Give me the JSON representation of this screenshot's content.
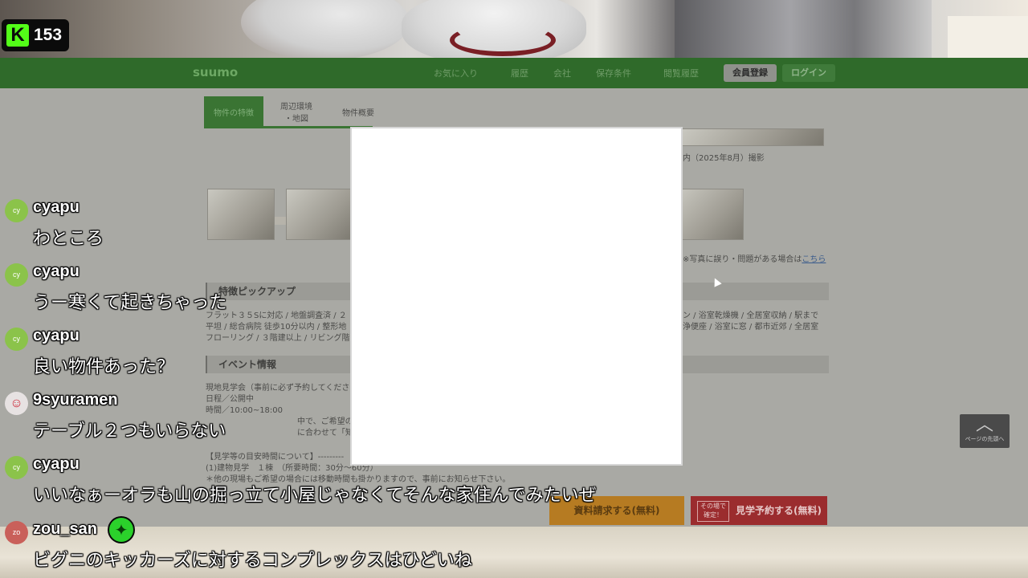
{
  "stream": {
    "viewer_count": "153"
  },
  "site": {
    "logo": "suumo",
    "nav": [
      "お気に入り",
      "履歴",
      "会社",
      "保存条件",
      "閲覧履歴"
    ],
    "register_label": "会員登録",
    "login_label": "ログイン"
  },
  "property": {
    "tabs": [
      "物件の特徴",
      "周辺環境\n・地図",
      "物件概要"
    ],
    "photo_caption": "内（2025年8月）撮影",
    "report_text": "※写真に誤り・問題がある場合は",
    "report_link": "こちら",
    "section_features": "特徴ピックアップ",
    "features_left": [
      "フラット３５Sに対応 / 地盤調査済 / ２",
      "平坦 / 総合病院 徒歩10分以内 / 整形地",
      "フローリング / ３階建以上 / リビング階"
    ],
    "features_right": [
      "ン / 浴室乾燥機 / 全居室収納 / 駅まで",
      "浄便座 / 浴室に窓 / 都市近郊 / 全居室"
    ],
    "section_event": "イベント情報",
    "event_lines": [
      "現地見学会（事前に必ず予約してくださ",
      "日程／公開中",
      "時間／10:00~18:00",
      "中で、ご希望の情報をご",
      "に合わせて「知りたい情",
      "【見学等の目安時間について】---------",
      "(1)建物見学　１棟　（所要時間：30分～60分）",
      "＊他の現場もご希望の場合には移動時間も掛かりますので、事前にお知らせ下さい。"
    ],
    "cta_request": "資料請求する(無料)",
    "cta_visit_small": "その場で\n確定！",
    "cta_visit": "見学予約する(無料)",
    "page_top": "ページの先頭へ"
  },
  "chat": [
    {
      "avatar": "cy",
      "avatar_color": "#8bc34a",
      "user": "cyapu",
      "text": "わところ"
    },
    {
      "avatar": "cy",
      "avatar_color": "#8bc34a",
      "user": "cyapu",
      "text": "うー寒くて起きちゃった"
    },
    {
      "avatar": "cy",
      "avatar_color": "#8bc34a",
      "user": "cyapu",
      "text": "良い物件あった？"
    },
    {
      "avatar": "",
      "avatar_color": "#e7e2e2",
      "user": "9syuramen",
      "text": "テーブル２つもいらない"
    },
    {
      "avatar": "cy",
      "avatar_color": "#8bc34a",
      "user": "cyapu",
      "text": "いいなぁーオラも山の掘っ立て小屋じゃなくてそんな家住んでみたいぜ"
    },
    {
      "avatar": "zo",
      "avatar_color": "#c9605a",
      "user": "zou_san",
      "text": "ビグニのキッカーズに対するコンプレックスはひどいね",
      "badge_icon": "verified-sparkle"
    }
  ]
}
